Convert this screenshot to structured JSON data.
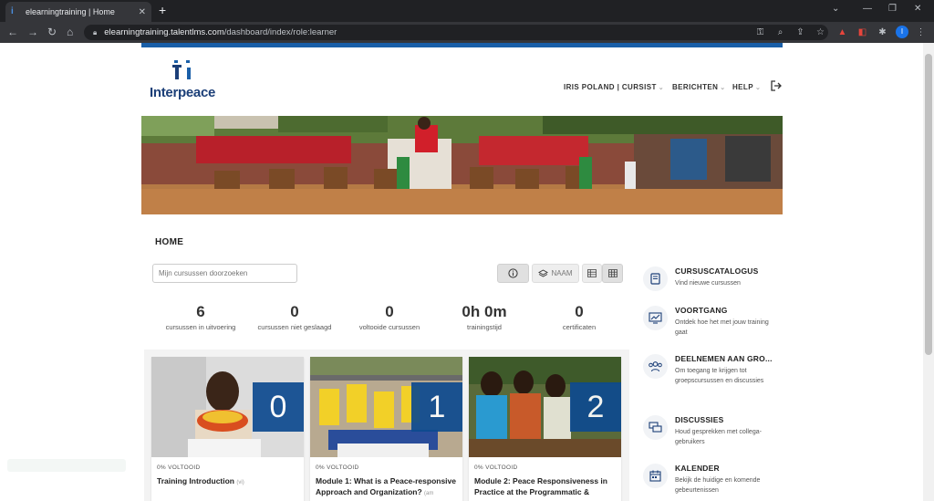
{
  "browser": {
    "tab_title": "elearningtraining | Home",
    "new_tab": "+",
    "url_host": "elearningtraining.talentlms.com",
    "url_path": "/dashboard/index/role:learner",
    "profile_initial": "I"
  },
  "site": {
    "logo_text": "Interpeace",
    "nav": {
      "user": "IRIS POLAND | CURSIST",
      "messages": "BERICHTEN",
      "help": "HELP"
    }
  },
  "main": {
    "title": "HOME",
    "search_placeholder": "Mijn cursussen doorzoeken",
    "sort_label": "NAAM",
    "stats": [
      {
        "value": "6",
        "label": "cursussen in uitvoering"
      },
      {
        "value": "0",
        "label": "cursussen niet geslaagd"
      },
      {
        "value": "0",
        "label": "voltooide cursussen"
      },
      {
        "value": "0h 0m",
        "label": "trainingstijd"
      },
      {
        "value": "0",
        "label": "certificaten"
      }
    ],
    "courses": [
      {
        "number": "0",
        "progress": "0% VOLTOOID",
        "title": "Training Introduction",
        "code": "(vi)"
      },
      {
        "number": "1",
        "progress": "0% VOLTOOID",
        "title": "Module 1: What is a Peace-responsive Approach and Organization?",
        "code": "(am"
      },
      {
        "number": "2",
        "progress": "0% VOLTOOID",
        "title": "Module 2: Peace Responsiveness in Practice at the Programmatic &",
        "code": ""
      }
    ]
  },
  "sidebar": [
    {
      "title": "CURSUSCATALOGUS",
      "desc": "Vind nieuwe cursussen"
    },
    {
      "title": "VOORTGANG",
      "desc": "Ontdek hoe het met jouw training gaat"
    },
    {
      "title": "DEELNEMEN AAN GRO...",
      "desc": "Om toegang te krijgen tot groepscursussen en discussies"
    },
    {
      "title": "DISCUSSIES",
      "desc": "Houd gesprekken met collega-gebruikers"
    },
    {
      "title": "KALENDER",
      "desc": "Bekijk de huidige en komende gebeurtenissen"
    }
  ],
  "colors": {
    "brand": "#1c3f78",
    "accent": "#0d4a8f",
    "chrome": "#202124"
  }
}
